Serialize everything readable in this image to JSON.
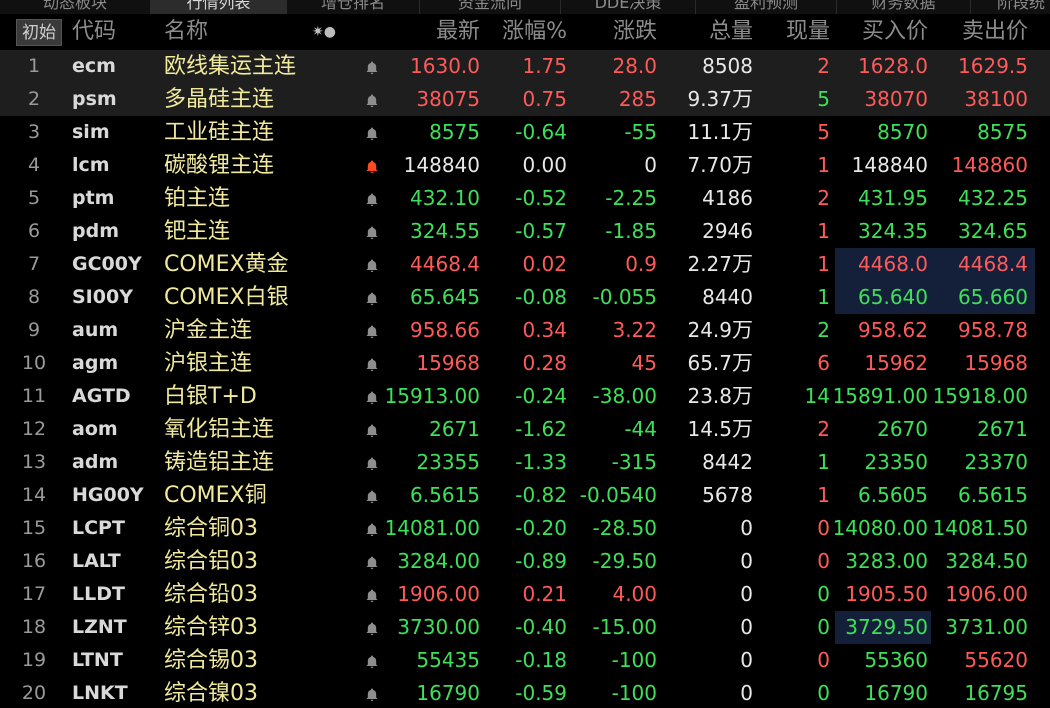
{
  "tabs": [
    {
      "label": "动态板块"
    },
    {
      "label": "行情列表"
    },
    {
      "label": "增仓排名"
    },
    {
      "label": "资金流向"
    },
    {
      "label": "DDE决策"
    },
    {
      "label": "盈利预测"
    },
    {
      "label": "财务数据"
    },
    {
      "label": "阶段统"
    }
  ],
  "header": {
    "init_button": "初始",
    "code": "代码",
    "name": "名称",
    "icons": "✷●",
    "last": "最新",
    "pct": "涨幅%",
    "chg": "涨跌",
    "vol": "总量",
    "cur": "现量",
    "bid": "买入价",
    "ask": "卖出价"
  },
  "colors": {
    "up": "#ff5a5a",
    "down": "#3ee05a",
    "flat": "#e8e8e8",
    "name": "#f1ea9c",
    "bell_alert": "#ff4a20",
    "bell": "#8e8e8e"
  },
  "rows": [
    {
      "num": "1",
      "code": "ecm",
      "name": "欧线集运主连",
      "bell": "normal",
      "last": "1630.0",
      "pct": "1.75",
      "chg": "28.0",
      "vol": "8508",
      "vol_unit": "",
      "cur": "2",
      "bid": "1628.0",
      "ask": "1629.5",
      "dir": "up",
      "cur_dir": "up",
      "bid_dir": "up",
      "ask_dir": "up"
    },
    {
      "num": "2",
      "code": "psm",
      "name": "多晶硅主连",
      "bell": "normal",
      "last": "38075",
      "pct": "0.75",
      "chg": "285",
      "vol": "9.37",
      "vol_unit": "万",
      "cur": "5",
      "bid": "38070",
      "ask": "38100",
      "dir": "up",
      "cur_dir": "dn",
      "bid_dir": "up",
      "ask_dir": "up"
    },
    {
      "num": "3",
      "code": "sim",
      "name": "工业硅主连",
      "bell": "normal",
      "last": "8575",
      "pct": "-0.64",
      "chg": "-55",
      "vol": "11.1",
      "vol_unit": "万",
      "cur": "5",
      "bid": "8570",
      "ask": "8575",
      "dir": "dn",
      "cur_dir": "up",
      "bid_dir": "dn",
      "ask_dir": "dn"
    },
    {
      "num": "4",
      "code": "lcm",
      "name": "碳酸锂主连",
      "bell": "alert",
      "last": "148840",
      "pct": "0.00",
      "chg": "0",
      "vol": "7.70",
      "vol_unit": "万",
      "cur": "1",
      "bid": "148840",
      "ask": "148860",
      "dir": "eq",
      "cur_dir": "up",
      "bid_dir": "eq",
      "ask_dir": "up"
    },
    {
      "num": "5",
      "code": "ptm",
      "name": "铂主连",
      "bell": "normal",
      "last": "432.10",
      "pct": "-0.52",
      "chg": "-2.25",
      "vol": "4186",
      "vol_unit": "",
      "cur": "2",
      "bid": "431.95",
      "ask": "432.25",
      "dir": "dn",
      "cur_dir": "up",
      "bid_dir": "dn",
      "ask_dir": "dn"
    },
    {
      "num": "6",
      "code": "pdm",
      "name": "钯主连",
      "bell": "normal",
      "last": "324.55",
      "pct": "-0.57",
      "chg": "-1.85",
      "vol": "2946",
      "vol_unit": "",
      "cur": "1",
      "bid": "324.35",
      "ask": "324.65",
      "dir": "dn",
      "cur_dir": "up",
      "bid_dir": "dn",
      "ask_dir": "dn"
    },
    {
      "num": "7",
      "code": "GC00Y",
      "name": "COMEX黄金",
      "bell": "normal",
      "last": "4468.4",
      "pct": "0.02",
      "chg": "0.9",
      "vol": "2.27",
      "vol_unit": "万",
      "cur": "1",
      "bid": "4468.0",
      "ask": "4468.4",
      "dir": "up",
      "cur_dir": "up",
      "bid_dir": "up",
      "ask_dir": "up",
      "hl": true
    },
    {
      "num": "8",
      "code": "SI00Y",
      "name": "COMEX白银",
      "bell": "normal",
      "last": "65.645",
      "pct": "-0.08",
      "chg": "-0.055",
      "vol": "8440",
      "vol_unit": "",
      "cur": "1",
      "bid": "65.640",
      "ask": "65.660",
      "dir": "dn",
      "cur_dir": "dn",
      "bid_dir": "dn",
      "ask_dir": "dn",
      "hl": true
    },
    {
      "num": "9",
      "code": "aum",
      "name": "沪金主连",
      "bell": "normal",
      "last": "958.66",
      "pct": "0.34",
      "chg": "3.22",
      "vol": "24.9",
      "vol_unit": "万",
      "cur": "2",
      "bid": "958.62",
      "ask": "958.78",
      "dir": "up",
      "cur_dir": "dn",
      "bid_dir": "up",
      "ask_dir": "up"
    },
    {
      "num": "10",
      "code": "agm",
      "name": "沪银主连",
      "bell": "normal",
      "last": "15968",
      "pct": "0.28",
      "chg": "45",
      "vol": "65.7",
      "vol_unit": "万",
      "cur": "6",
      "bid": "15962",
      "ask": "15968",
      "dir": "up",
      "cur_dir": "up",
      "bid_dir": "up",
      "ask_dir": "up"
    },
    {
      "num": "11",
      "code": "AGTD",
      "name": "白银T+D",
      "bell": "normal",
      "last": "15913.00",
      "pct": "-0.24",
      "chg": "-38.00",
      "vol": "23.8",
      "vol_unit": "万",
      "cur": "14",
      "bid": "15891.00",
      "ask": "15918.00",
      "dir": "dn",
      "cur_dir": "dn",
      "bid_dir": "dn",
      "ask_dir": "dn"
    },
    {
      "num": "12",
      "code": "aom",
      "name": "氧化铝主连",
      "bell": "normal",
      "last": "2671",
      "pct": "-1.62",
      "chg": "-44",
      "vol": "14.5",
      "vol_unit": "万",
      "cur": "2",
      "bid": "2670",
      "ask": "2671",
      "dir": "dn",
      "cur_dir": "up",
      "bid_dir": "dn",
      "ask_dir": "dn"
    },
    {
      "num": "13",
      "code": "adm",
      "name": "铸造铝主连",
      "bell": "normal",
      "last": "23355",
      "pct": "-1.33",
      "chg": "-315",
      "vol": "8442",
      "vol_unit": "",
      "cur": "1",
      "bid": "23350",
      "ask": "23370",
      "dir": "dn",
      "cur_dir": "dn",
      "bid_dir": "dn",
      "ask_dir": "dn"
    },
    {
      "num": "14",
      "code": "HG00Y",
      "name": "COMEX铜",
      "bell": "normal",
      "last": "6.5615",
      "pct": "-0.82",
      "chg": "-0.0540",
      "vol": "5678",
      "vol_unit": "",
      "cur": "1",
      "bid": "6.5605",
      "ask": "6.5615",
      "dir": "dn",
      "cur_dir": "up",
      "bid_dir": "dn",
      "ask_dir": "dn"
    },
    {
      "num": "15",
      "code": "LCPT",
      "name": "综合铜03",
      "bell": "normal",
      "last": "14081.00",
      "pct": "-0.20",
      "chg": "-28.50",
      "vol": "0",
      "vol_unit": "",
      "cur": "0",
      "bid": "14080.00",
      "ask": "14081.50",
      "dir": "dn",
      "cur_dir": "up",
      "bid_dir": "dn",
      "ask_dir": "dn"
    },
    {
      "num": "16",
      "code": "LALT",
      "name": "综合铝03",
      "bell": "normal",
      "last": "3284.00",
      "pct": "-0.89",
      "chg": "-29.50",
      "vol": "0",
      "vol_unit": "",
      "cur": "0",
      "bid": "3283.00",
      "ask": "3284.50",
      "dir": "dn",
      "cur_dir": "up",
      "bid_dir": "dn",
      "ask_dir": "dn"
    },
    {
      "num": "17",
      "code": "LLDT",
      "name": "综合铅03",
      "bell": "normal",
      "last": "1906.00",
      "pct": "0.21",
      "chg": "4.00",
      "vol": "0",
      "vol_unit": "",
      "cur": "0",
      "bid": "1905.50",
      "ask": "1906.00",
      "dir": "up",
      "cur_dir": "dn",
      "bid_dir": "up",
      "ask_dir": "up"
    },
    {
      "num": "18",
      "code": "LZNT",
      "name": "综合锌03",
      "bell": "normal",
      "last": "3730.00",
      "pct": "-0.40",
      "chg": "-15.00",
      "vol": "0",
      "vol_unit": "",
      "cur": "0",
      "bid": "3729.50",
      "ask": "3731.00",
      "dir": "dn",
      "cur_dir": "dn",
      "bid_dir": "dn",
      "ask_dir": "dn",
      "hl_bid": true
    },
    {
      "num": "19",
      "code": "LTNT",
      "name": "综合锡03",
      "bell": "normal",
      "last": "55435",
      "pct": "-0.18",
      "chg": "-100",
      "vol": "0",
      "vol_unit": "",
      "cur": "0",
      "bid": "55360",
      "ask": "55620",
      "dir": "dn",
      "cur_dir": "up",
      "bid_dir": "dn",
      "ask_dir": "up"
    },
    {
      "num": "20",
      "code": "LNKT",
      "name": "综合镍03",
      "bell": "normal",
      "last": "16790",
      "pct": "-0.59",
      "chg": "-100",
      "vol": "0",
      "vol_unit": "",
      "cur": "0",
      "bid": "16790",
      "ask": "16795",
      "dir": "dn",
      "cur_dir": "dn",
      "bid_dir": "dn",
      "ask_dir": "dn"
    }
  ]
}
